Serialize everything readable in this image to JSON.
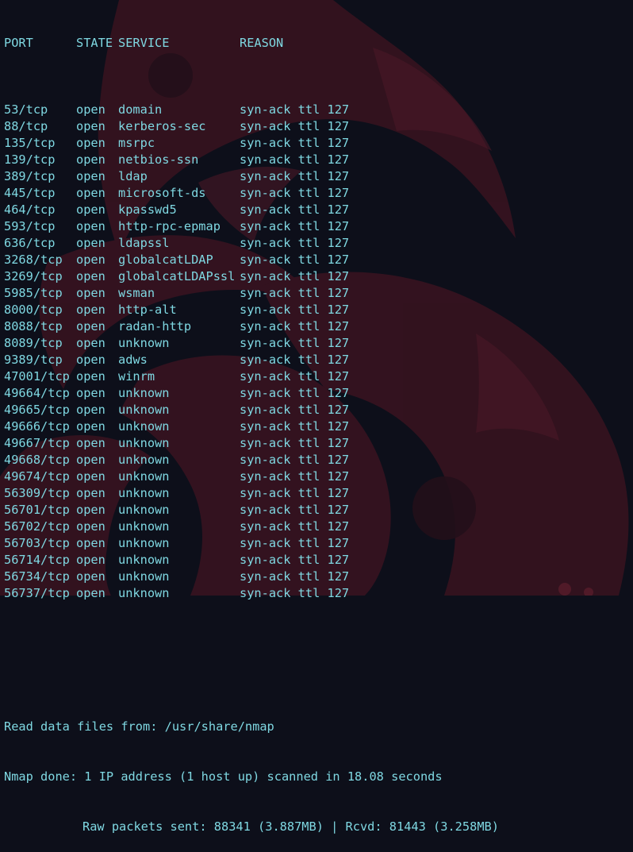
{
  "header": {
    "port": "PORT",
    "state": "STATE",
    "service": "SERVICE",
    "reason": "REASON"
  },
  "rows": [
    {
      "port": "53/tcp",
      "state": "open",
      "service": "domain",
      "reason": "syn-ack ttl 127"
    },
    {
      "port": "88/tcp",
      "state": "open",
      "service": "kerberos-sec",
      "reason": "syn-ack ttl 127"
    },
    {
      "port": "135/tcp",
      "state": "open",
      "service": "msrpc",
      "reason": "syn-ack ttl 127"
    },
    {
      "port": "139/tcp",
      "state": "open",
      "service": "netbios-ssn",
      "reason": "syn-ack ttl 127"
    },
    {
      "port": "389/tcp",
      "state": "open",
      "service": "ldap",
      "reason": "syn-ack ttl 127"
    },
    {
      "port": "445/tcp",
      "state": "open",
      "service": "microsoft-ds",
      "reason": "syn-ack ttl 127"
    },
    {
      "port": "464/tcp",
      "state": "open",
      "service": "kpasswd5",
      "reason": "syn-ack ttl 127"
    },
    {
      "port": "593/tcp",
      "state": "open",
      "service": "http-rpc-epmap",
      "reason": "syn-ack ttl 127"
    },
    {
      "port": "636/tcp",
      "state": "open",
      "service": "ldapssl",
      "reason": "syn-ack ttl 127"
    },
    {
      "port": "3268/tcp",
      "state": "open",
      "service": "globalcatLDAP",
      "reason": "syn-ack ttl 127"
    },
    {
      "port": "3269/tcp",
      "state": "open",
      "service": "globalcatLDAPssl",
      "reason": "syn-ack ttl 127"
    },
    {
      "port": "5985/tcp",
      "state": "open",
      "service": "wsman",
      "reason": "syn-ack ttl 127"
    },
    {
      "port": "8000/tcp",
      "state": "open",
      "service": "http-alt",
      "reason": "syn-ack ttl 127"
    },
    {
      "port": "8088/tcp",
      "state": "open",
      "service": "radan-http",
      "reason": "syn-ack ttl 127"
    },
    {
      "port": "8089/tcp",
      "state": "open",
      "service": "unknown",
      "reason": "syn-ack ttl 127"
    },
    {
      "port": "9389/tcp",
      "state": "open",
      "service": "adws",
      "reason": "syn-ack ttl 127"
    },
    {
      "port": "47001/tcp",
      "state": "open",
      "service": "winrm",
      "reason": "syn-ack ttl 127"
    },
    {
      "port": "49664/tcp",
      "state": "open",
      "service": "unknown",
      "reason": "syn-ack ttl 127"
    },
    {
      "port": "49665/tcp",
      "state": "open",
      "service": "unknown",
      "reason": "syn-ack ttl 127"
    },
    {
      "port": "49666/tcp",
      "state": "open",
      "service": "unknown",
      "reason": "syn-ack ttl 127"
    },
    {
      "port": "49667/tcp",
      "state": "open",
      "service": "unknown",
      "reason": "syn-ack ttl 127"
    },
    {
      "port": "49668/tcp",
      "state": "open",
      "service": "unknown",
      "reason": "syn-ack ttl 127"
    },
    {
      "port": "49674/tcp",
      "state": "open",
      "service": "unknown",
      "reason": "syn-ack ttl 127"
    },
    {
      "port": "56309/tcp",
      "state": "open",
      "service": "unknown",
      "reason": "syn-ack ttl 127"
    },
    {
      "port": "56701/tcp",
      "state": "open",
      "service": "unknown",
      "reason": "syn-ack ttl 127"
    },
    {
      "port": "56702/tcp",
      "state": "open",
      "service": "unknown",
      "reason": "syn-ack ttl 127"
    },
    {
      "port": "56703/tcp",
      "state": "open",
      "service": "unknown",
      "reason": "syn-ack ttl 127"
    },
    {
      "port": "56714/tcp",
      "state": "open",
      "service": "unknown",
      "reason": "syn-ack ttl 127"
    },
    {
      "port": "56734/tcp",
      "state": "open",
      "service": "unknown",
      "reason": "syn-ack ttl 127"
    },
    {
      "port": "56737/tcp",
      "state": "open",
      "service": "unknown",
      "reason": "syn-ack ttl 127"
    }
  ],
  "footer": {
    "read_data": "Read data files from: /usr/share/nmap",
    "nmap_done": "Nmap done: 1 IP address (1 host up) scanned in 18.08 seconds",
    "raw_packets": "Raw packets sent: 88341 (3.887MB) | Rcvd: 81443 (3.258MB)"
  },
  "colors": {
    "text": "#7fd8e2",
    "background": "#0d0f1a",
    "wallpaper_accent": "#5a1f2e"
  },
  "wallpaper": {
    "icon": "red-mascot-wallpaper-icon"
  }
}
